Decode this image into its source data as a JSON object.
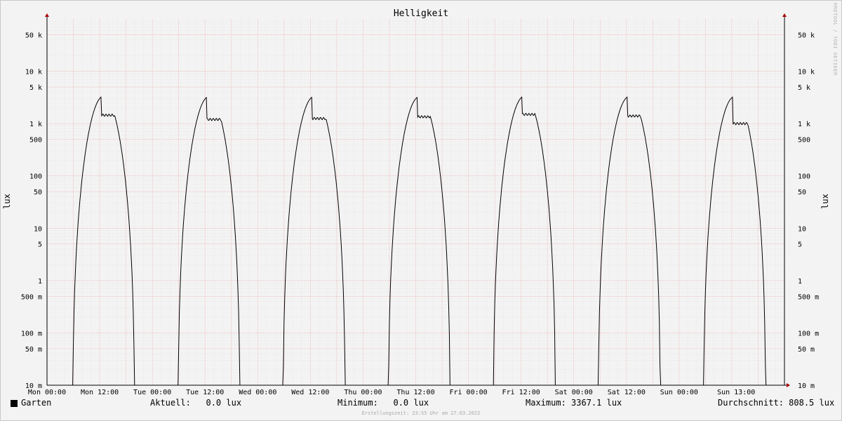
{
  "chart_data": {
    "type": "line",
    "title": "Helligkeit",
    "ylabel": "lux",
    "y_scale": "log",
    "ylim_lux": [
      0.01,
      100000
    ],
    "yticks": [
      {
        "value": 50000,
        "label": "50 k"
      },
      {
        "value": 10000,
        "label": "10 k"
      },
      {
        "value": 5000,
        "label": "5 k"
      },
      {
        "value": 1000,
        "label": "1 k"
      },
      {
        "value": 500,
        "label": "500"
      },
      {
        "value": 100,
        "label": "100"
      },
      {
        "value": 50,
        "label": "50"
      },
      {
        "value": 10,
        "label": "10"
      },
      {
        "value": 5,
        "label": "5"
      },
      {
        "value": 1,
        "label": "1"
      },
      {
        "value": 0.5,
        "label": "500 m"
      },
      {
        "value": 0.1,
        "label": "100 m"
      },
      {
        "value": 0.05,
        "label": "50 m"
      },
      {
        "value": 0.01,
        "label": "10 m"
      }
    ],
    "x_unit": "hours since Mon 00:00",
    "xlim_hours": [
      0,
      168
    ],
    "xticks": [
      {
        "value": 0,
        "label": "Mon 00:00"
      },
      {
        "value": 12,
        "label": "Mon 12:00"
      },
      {
        "value": 24,
        "label": "Tue 00:00"
      },
      {
        "value": 36,
        "label": "Tue 12:00"
      },
      {
        "value": 48,
        "label": "Wed 00:00"
      },
      {
        "value": 60,
        "label": "Wed 12:00"
      },
      {
        "value": 72,
        "label": "Thu 00:00"
      },
      {
        "value": 84,
        "label": "Thu 12:00"
      },
      {
        "value": 96,
        "label": "Fri 00:00"
      },
      {
        "value": 108,
        "label": "Fri 12:00"
      },
      {
        "value": 120,
        "label": "Sat 00:00"
      },
      {
        "value": 132,
        "label": "Sat 12:00"
      },
      {
        "value": 144,
        "label": "Sun 00:00"
      },
      {
        "value": 157,
        "label": "Sun 13:00"
      }
    ],
    "grid": true,
    "series": [
      {
        "name": "Garten",
        "color": "#000000",
        "daylight": [
          {
            "rise": 5.9,
            "set": 19.9,
            "peak": 3367,
            "dip_at": 14.2,
            "dip": 1450
          },
          {
            "rise": 29.9,
            "set": 43.9,
            "peak": 3300,
            "dip_at": 38.0,
            "dip": 1200
          },
          {
            "rise": 53.8,
            "set": 67.9,
            "peak": 3300,
            "dip_at": 62.5,
            "dip": 1250
          },
          {
            "rise": 77.8,
            "set": 91.8,
            "peak": 3250,
            "dip_at": 88.2,
            "dip": 1350
          },
          {
            "rise": 101.7,
            "set": 115.8,
            "peak": 3350,
            "dip_at": 110.2,
            "dip": 1500
          },
          {
            "rise": 125.6,
            "set": 139.7,
            "peak": 3300,
            "dip_at": 134.5,
            "dip": 1400
          },
          {
            "rise": 149.6,
            "set": 163.7,
            "peak": 3300,
            "dip_at": 158.5,
            "dip": 1000
          }
        ]
      }
    ],
    "legend": {
      "series_label": "Garten",
      "current_label": "Aktuell:",
      "current": "0.0 lux",
      "min_label": "Minimum:",
      "min": "0.0 lux",
      "max_label": "Maximum:",
      "max": "3367.1 lux",
      "avg_label": "Durchschnitt:",
      "avg": "808.5 lux"
    }
  },
  "footer": "Erstellungszeit: 23:55 Uhr am 27.03.2022",
  "watermark": "RRDTOOL / TOBI OETIKER"
}
